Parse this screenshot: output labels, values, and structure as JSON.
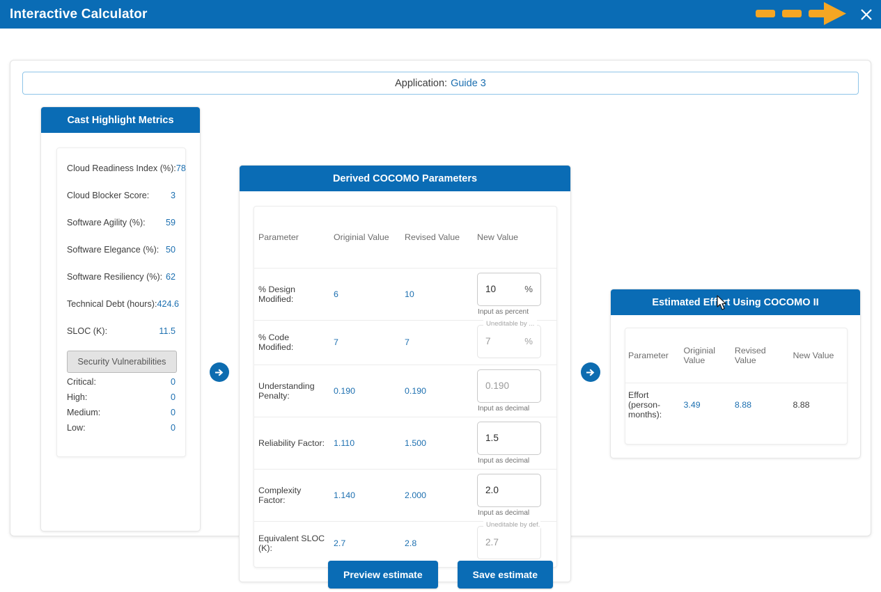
{
  "titlebar": {
    "title": "Interactive Calculator",
    "close_label": "✕",
    "arrow_icon": "dashed-right-arrow",
    "close_icon": "close-icon",
    "accent_blue": "#0a6cb5",
    "arrow_orange": "#f5a623"
  },
  "app_bar": {
    "label": "Application:",
    "value": "Guide 3"
  },
  "left_panel": {
    "title": "Cast Highlight Metrics",
    "metrics": [
      {
        "label": "Cloud Readiness Index (%):",
        "value": "78"
      },
      {
        "label": "Cloud Blocker Score:",
        "value": "3"
      },
      {
        "label": "Software Agility (%):",
        "value": "59"
      },
      {
        "label": "Software Elegance (%):",
        "value": "50"
      },
      {
        "label": "Software Resiliency (%):",
        "value": "62"
      },
      {
        "label": "Technical Debt (hours):",
        "value": "424.6"
      },
      {
        "label": "SLOC (K):",
        "value": "11.5"
      }
    ],
    "vuln_button": "Security Vulnerabilities",
    "vulnerabilities": [
      {
        "label": "Critical:",
        "value": "0"
      },
      {
        "label": "High:",
        "value": "0"
      },
      {
        "label": "Medium:",
        "value": "0"
      },
      {
        "label": "Low:",
        "value": "0"
      }
    ]
  },
  "mid_panel": {
    "title": "Derived COCOMO Parameters",
    "columns": [
      "Parameter",
      "Originial Value",
      "Revised Value",
      "New Value"
    ],
    "rows": [
      {
        "parameter": "% Design Modified:",
        "original": "6",
        "revised": "10",
        "new_value": "10",
        "unit": "%",
        "hint": "Input as percent",
        "legend": "",
        "disabled": false,
        "placeholder": false
      },
      {
        "parameter": "% Code Modified:",
        "original": "7",
        "revised": "7",
        "new_value": "7",
        "unit": "%",
        "hint": "",
        "legend": "Uneditable by ...",
        "disabled": true,
        "placeholder": true
      },
      {
        "parameter": "Understanding Penalty:",
        "original": "0.190",
        "revised": "0.190",
        "new_value": "0.190",
        "unit": "",
        "hint": "Input as decimal",
        "legend": "",
        "disabled": false,
        "placeholder": true
      },
      {
        "parameter": "Reliability Factor:",
        "original": "1.110",
        "revised": "1.500",
        "new_value": "1.5",
        "unit": "",
        "hint": "Input as decimal",
        "legend": "",
        "disabled": false,
        "placeholder": false
      },
      {
        "parameter": "Complexity Factor:",
        "original": "1.140",
        "revised": "2.000",
        "new_value": "2.0",
        "unit": "",
        "hint": "Input as decimal",
        "legend": "",
        "disabled": false,
        "placeholder": false
      },
      {
        "parameter": "Equivalent SLOC (K):",
        "original": "2.7",
        "revised": "2.8",
        "new_value": "2.7",
        "unit": "",
        "hint": "",
        "legend": "Uneditable by def...",
        "disabled": true,
        "placeholder": true
      }
    ]
  },
  "right_panel": {
    "title": "Estimated Effort Using COCOMO II",
    "columns": [
      "Parameter",
      "Originial Value",
      "Revised Value",
      "New Value"
    ],
    "rows": [
      {
        "parameter": "Effort (person-months):",
        "original": "3.49",
        "revised": "8.88",
        "new_value": "8.88"
      }
    ]
  },
  "arrows": {
    "arrow_1": "arrow-right-circle-icon",
    "arrow_2": "arrow-right-circle-icon"
  },
  "footer": {
    "preview_label": "Preview estimate",
    "save_label": "Save estimate"
  }
}
